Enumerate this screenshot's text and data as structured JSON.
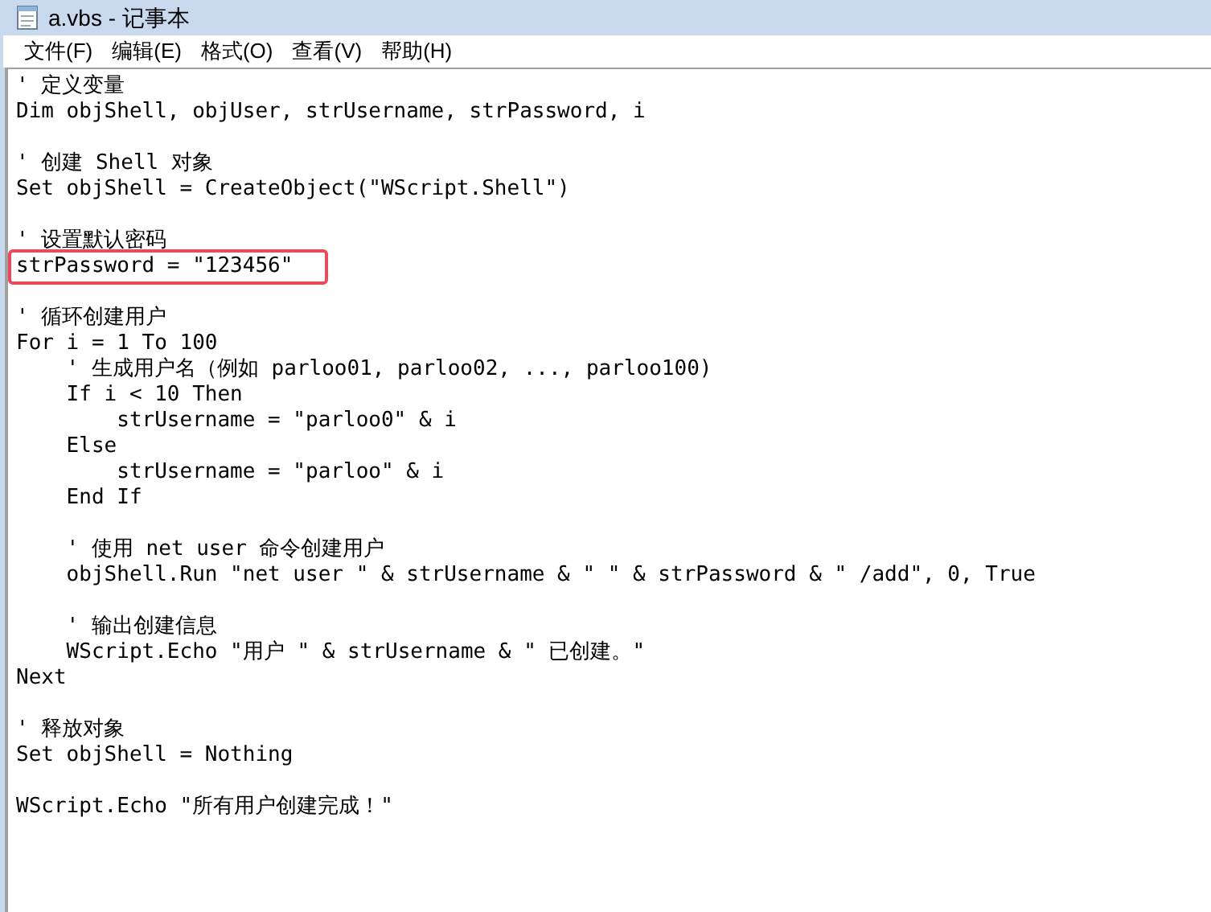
{
  "window": {
    "title": "a.vbs - 记事本"
  },
  "menu": [
    {
      "label": "文件(F)"
    },
    {
      "label": "编辑(E)"
    },
    {
      "label": "格式(O)"
    },
    {
      "label": "查看(V)"
    },
    {
      "label": "帮助(H)"
    }
  ],
  "lines": [
    {
      "kind": "code",
      "text": "' 定义变量",
      "highlighted": false
    },
    {
      "kind": "code",
      "text": "Dim objShell, objUser, strUsername, strPassword, i",
      "highlighted": false
    },
    {
      "kind": "blank"
    },
    {
      "kind": "code",
      "text": "' 创建 Shell 对象",
      "highlighted": false
    },
    {
      "kind": "code",
      "text": "Set objShell = CreateObject(\"WScript.Shell\")",
      "highlighted": false
    },
    {
      "kind": "blank"
    },
    {
      "kind": "code",
      "text": "' 设置默认密码",
      "highlighted": false
    },
    {
      "kind": "code",
      "text": "strPassword = \"123456\"",
      "highlighted": true
    },
    {
      "kind": "blank"
    },
    {
      "kind": "code",
      "text": "' 循环创建用户",
      "highlighted": false
    },
    {
      "kind": "code",
      "text": "For i = 1 To 100",
      "highlighted": false
    },
    {
      "kind": "code",
      "text": "    ' 生成用户名（例如 parloo01, parloo02, ..., parloo100)",
      "highlighted": false
    },
    {
      "kind": "code",
      "text": "    If i < 10 Then",
      "highlighted": false
    },
    {
      "kind": "code",
      "text": "        strUsername = \"parloo0\" & i",
      "highlighted": false
    },
    {
      "kind": "code",
      "text": "    Else",
      "highlighted": false
    },
    {
      "kind": "code",
      "text": "        strUsername = \"parloo\" & i",
      "highlighted": false
    },
    {
      "kind": "code",
      "text": "    End If",
      "highlighted": false
    },
    {
      "kind": "blank"
    },
    {
      "kind": "code",
      "text": "    ' 使用 net user 命令创建用户",
      "highlighted": false
    },
    {
      "kind": "code",
      "text": "    objShell.Run \"net user \" & strUsername & \" \" & strPassword & \" /add\", 0, True",
      "highlighted": false
    },
    {
      "kind": "blank"
    },
    {
      "kind": "code",
      "text": "    ' 输出创建信息",
      "highlighted": false
    },
    {
      "kind": "code",
      "text": "    WScript.Echo \"用户 \" & strUsername & \" 已创建。\"",
      "highlighted": false
    },
    {
      "kind": "code",
      "text": "Next",
      "highlighted": false
    },
    {
      "kind": "blank"
    },
    {
      "kind": "code",
      "text": "' 释放对象",
      "highlighted": false
    },
    {
      "kind": "code",
      "text": "Set objShell = Nothing",
      "highlighted": false
    },
    {
      "kind": "blank"
    },
    {
      "kind": "code",
      "text": "WScript.Echo \"所有用户创建完成！\"",
      "highlighted": false
    }
  ]
}
